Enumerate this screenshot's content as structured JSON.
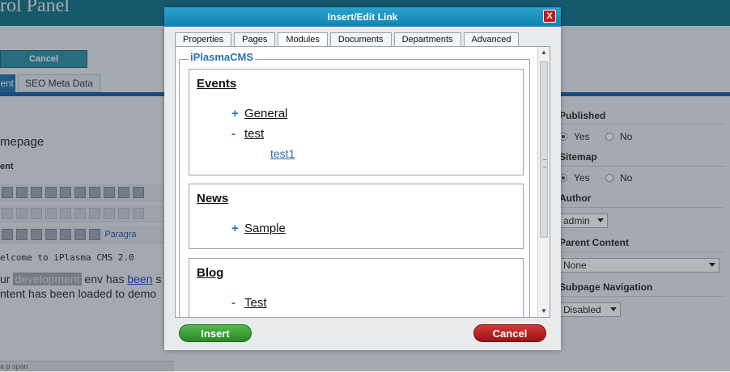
{
  "background": {
    "app_title": "rol Panel",
    "cancel_label": "Cancel",
    "tabs": [
      "ent",
      "SEO Meta Data"
    ],
    "homepage_field": "mepage",
    "content_label": "ent",
    "format_label": "Paragra",
    "welcome_text": "elcome to iPlasma CMS 2.0",
    "body_line1": {
      "prefix": "ur ",
      "highlight": "development",
      "mid": " env has ",
      "link": "been",
      "suffix": " s"
    },
    "body_line2": "ntent has been loaded to demo",
    "status_text": "a p span",
    "right_panel": {
      "published": {
        "label": "Published",
        "yes": "Yes",
        "no": "No",
        "selected": "Yes"
      },
      "sitemap": {
        "label": "Sitemap",
        "yes": "Yes",
        "no": "No",
        "selected": "Yes"
      },
      "author": {
        "label": "Author",
        "value": "admin"
      },
      "parent_content": {
        "label": "Parent Content",
        "value": "None"
      },
      "subpage_navigation": {
        "label": "Subpage Navigation",
        "value": "Disabled"
      }
    }
  },
  "dialog": {
    "title": "Insert/Edit Link",
    "close_symbol": "X",
    "tabs": [
      {
        "label": "Properties",
        "active": false
      },
      {
        "label": "Pages",
        "active": false
      },
      {
        "label": "Modules",
        "active": true
      },
      {
        "label": "Documents",
        "active": false
      },
      {
        "label": "Departments",
        "active": false
      },
      {
        "label": "Advanced",
        "active": false
      }
    ],
    "group_legend": "iPlasmaCMS",
    "sections": [
      {
        "title": "Events",
        "items": [
          {
            "symbol": "+",
            "label": "General"
          },
          {
            "symbol": "-",
            "label": "test"
          },
          {
            "symbol": "",
            "label": "test1"
          }
        ]
      },
      {
        "title": "News",
        "items": [
          {
            "symbol": "+",
            "label": "Sample"
          }
        ]
      },
      {
        "title": "Blog",
        "items": [
          {
            "symbol": "-",
            "label": "Test"
          }
        ]
      }
    ],
    "insert_label": "Insert",
    "cancel_label": "Cancel"
  },
  "colors": {
    "header_teal": "#0f6f86",
    "dialog_title_blue": "#1282b0",
    "insert_green": "#268a20",
    "cancel_red": "#9c1214",
    "legend_blue": "#2f6fb1"
  }
}
